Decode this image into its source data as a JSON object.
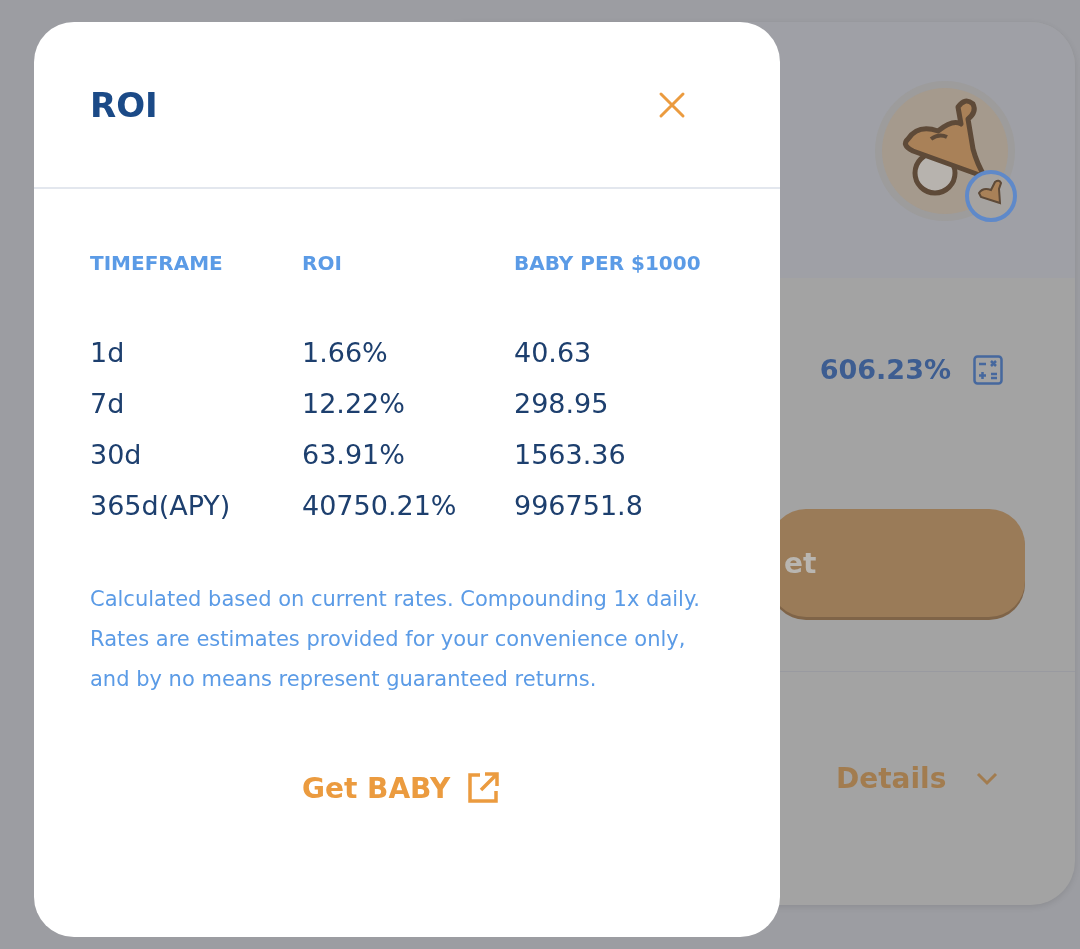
{
  "farm_card": {
    "apr": "606.23%",
    "button_label": "et",
    "details_label": "Details"
  },
  "modal": {
    "title": "ROI",
    "columns": [
      "TIMEFRAME",
      "ROI",
      "BABY PER $1000"
    ],
    "rows": [
      [
        "1d",
        "1.66%",
        "40.63"
      ],
      [
        "7d",
        "12.22%",
        "298.95"
      ],
      [
        "30d",
        "63.91%",
        "1563.36"
      ],
      [
        "365d(APY)",
        "40750.21%",
        "996751.8"
      ]
    ],
    "note": "Calculated based on current rates. Compounding 1x daily. Rates are estimates provided for your convenience only, and by no means represent guaranteed returns.",
    "link": "Get BABY"
  }
}
